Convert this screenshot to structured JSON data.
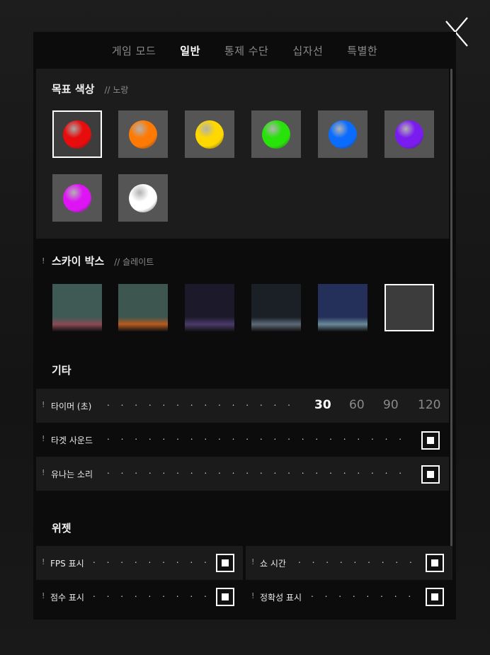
{
  "tabs": [
    {
      "label": "게임 모드"
    },
    {
      "label": "일반",
      "active": true
    },
    {
      "label": "통제 수단"
    },
    {
      "label": "십자선"
    },
    {
      "label": "특별한"
    }
  ],
  "target_color": {
    "title": "목표 색상",
    "subtitle": "// 노랑",
    "swatches": [
      {
        "name": "red",
        "color": "#e80c0c",
        "selected": true
      },
      {
        "name": "orange",
        "color": "#ff7a05"
      },
      {
        "name": "yellow",
        "color": "#ffd800"
      },
      {
        "name": "green",
        "color": "#28e30a"
      },
      {
        "name": "blue",
        "color": "#0a6cff"
      },
      {
        "name": "purple",
        "color": "#7a1bf0"
      },
      {
        "name": "magenta",
        "color": "#df14f5"
      },
      {
        "name": "white",
        "color": "#ffffff"
      }
    ]
  },
  "skybox": {
    "warning": "!",
    "title": "스카이 박스",
    "subtitle": "// 슬레이트",
    "options": [
      {
        "name": "teal-dusk",
        "top": "#3f5a55",
        "bottom": "#8a4a55"
      },
      {
        "name": "teal-sunset",
        "top": "#3d5650",
        "bottom": "#b75a1e"
      },
      {
        "name": "violet-night",
        "top": "#1c1a2a",
        "bottom": "#4a3a6a"
      },
      {
        "name": "slate-dark",
        "top": "#1b1f26",
        "bottom": "#5d6a78"
      },
      {
        "name": "blue-night",
        "top": "#24305a",
        "bottom": "#6a8a9a"
      },
      {
        "name": "slate",
        "top": "#3c3c3c",
        "bottom": "#3c3c3c",
        "selected": true
      }
    ]
  },
  "misc": {
    "title": "기타",
    "timer": {
      "warning": "!",
      "label": "타이머 (초)",
      "dots": ". . . . . . . . . . . . . . . . . . .",
      "options": [
        "30",
        "60",
        "90",
        "120"
      ],
      "selected": "30"
    },
    "target_sound": {
      "warning": "!",
      "label": "타겟 사운드",
      "dots": ". . . . . . . . . . . . . . . . . . . . . . . . . . .",
      "checked": true
    },
    "ring_sound": {
      "warning": "!",
      "label": "유나는 소리",
      "dots": ". . . . . . . . . . . . . . . . . . . . . . . . . . .",
      "checked": true
    }
  },
  "widgets": {
    "title": "위젯",
    "items": [
      {
        "warning": "!",
        "label": "FPS 표시",
        "dots": ". . . . . . . . . . . .",
        "checked": true
      },
      {
        "warning": "!",
        "label": "쇼 시간",
        "dots": ". . . . . . . . . . . .",
        "checked": true
      },
      {
        "warning": "!",
        "label": "점수 표시",
        "dots": ". . . . . . . . . . . .",
        "checked": true
      },
      {
        "warning": "!",
        "label": "정확성 표시",
        "dots": ". . . . . . . . . .",
        "checked": true
      }
    ]
  },
  "colors": {
    "accent": "#ffffff",
    "panel": "#0c0c0c",
    "section": "#1c1c1c"
  }
}
